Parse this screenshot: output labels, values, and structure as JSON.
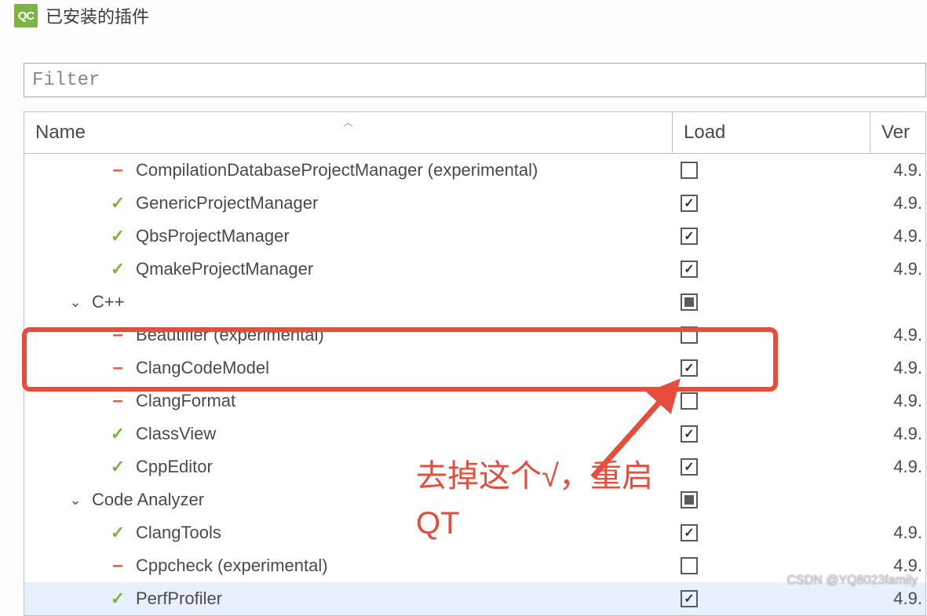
{
  "window": {
    "title": "已安装的插件",
    "icon_label": "QC"
  },
  "filter": {
    "placeholder": "Filter"
  },
  "columns": {
    "name": "Name",
    "load": "Load",
    "version": "Ver"
  },
  "rows": [
    {
      "indent": 2,
      "status": "minus",
      "name": "CompilationDatabaseProjectManager (experimental)",
      "load": "unchecked",
      "version": "4.9."
    },
    {
      "indent": 2,
      "status": "check",
      "name": "GenericProjectManager",
      "load": "checked",
      "version": "4.9."
    },
    {
      "indent": 2,
      "status": "check",
      "name": "QbsProjectManager",
      "load": "checked",
      "version": "4.9."
    },
    {
      "indent": 2,
      "status": "check",
      "name": "QmakeProjectManager",
      "load": "checked",
      "version": "4.9."
    },
    {
      "indent": 1,
      "expand": "open",
      "status": "",
      "name": "C++",
      "load": "partial",
      "version": ""
    },
    {
      "indent": 2,
      "status": "minus",
      "name": "Beautifier (experimental)",
      "load": "unchecked",
      "version": "4.9."
    },
    {
      "indent": 2,
      "status": "minus",
      "name": "ClangCodeModel",
      "load": "checked",
      "version": "4.9."
    },
    {
      "indent": 2,
      "status": "minus",
      "name": "ClangFormat",
      "load": "unchecked",
      "version": "4.9."
    },
    {
      "indent": 2,
      "status": "check",
      "name": "ClassView",
      "load": "checked",
      "version": "4.9."
    },
    {
      "indent": 2,
      "status": "check",
      "name": "CppEditor",
      "load": "checked",
      "version": "4.9."
    },
    {
      "indent": 1,
      "expand": "open",
      "status": "",
      "name": "Code Analyzer",
      "load": "partial",
      "version": ""
    },
    {
      "indent": 2,
      "status": "check",
      "name": "ClangTools",
      "load": "checked",
      "version": "4.9."
    },
    {
      "indent": 2,
      "status": "minus",
      "name": "Cppcheck (experimental)",
      "load": "unchecked",
      "version": "4.9."
    },
    {
      "indent": 2,
      "status": "check",
      "name": "PerfProfiler",
      "load": "checked",
      "version": "4.9.",
      "selected": true
    }
  ],
  "annotation": {
    "text": "去掉这个√，重启QT"
  },
  "watermark": "CSDN @YQ8023family"
}
